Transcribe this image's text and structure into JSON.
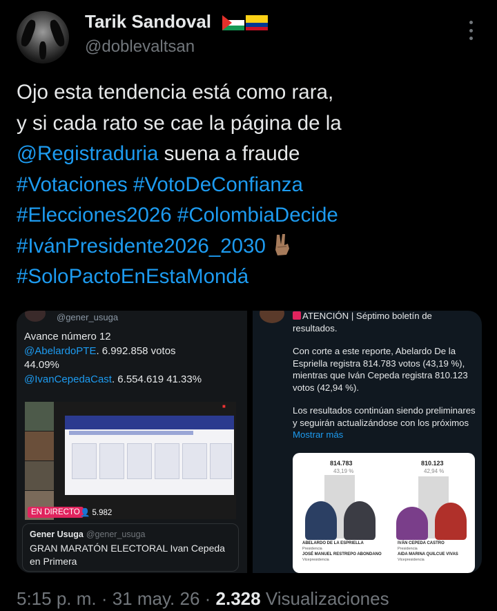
{
  "author": {
    "name": "Tarik Sandoval",
    "handle": "@doblevaltsan",
    "flags": [
      "palestine-flag",
      "colombia-flag"
    ]
  },
  "tweet": {
    "line1": "Ojo esta tendencia está como rara,",
    "line2": "y si cada rato se cae la página de la",
    "mention": "@Registraduria",
    "line3_rest": " suena a fraude",
    "hashtags": {
      "votaciones": "#Votaciones",
      "voto": "#VotoDeConfianza",
      "elecciones": "#Elecciones2026",
      "colombia": "#ColombiaDecide",
      "ivan": "#IvánPresidente2026_2030",
      "solo": "#SoloPactoEnEstaMondá"
    }
  },
  "left_panel": {
    "handle": "@gener_usuga",
    "advance": "Avance número 12",
    "mention1": "@AbelardoPTE",
    "votes1": ". 6.992.858 votos",
    "pct1": "44.09%",
    "mention2": "@IvanCepedaCast",
    "votes2": ". 6.554.619 41.33%",
    "live_label": "EN DIRECTO",
    "viewers": "5.982",
    "quote_author": "Gener Usuga",
    "quote_handle": "@gener_usuga",
    "quote_text": "GRAN MARATÓN ELECTORAL Ivan Cepeda en Primera"
  },
  "right_panel": {
    "alert": "ATENCIÓN | Séptimo boletín de resultados.",
    "para1": "Con corte a este reporte, Abelardo De la Espriella registra 814.783 votos (43,19 %), mientras que Iván Cepeda registra 810.123 votos (42,94 %).",
    "para2": "Los resultados continúan siendo preliminares y seguirán actualizándose con los próximos ",
    "show_more": "Mostrar más",
    "chart": {
      "left_value": "814.783",
      "left_pct": "43,19 %",
      "right_value": "810.123",
      "right_pct": "42,94 %",
      "left_name": "ABELARDO DE LA ESPRIELLA",
      "left_role": "Presidencia",
      "left_vp": "JOSÉ MANUEL RESTREPO ABONDANO",
      "left_vp_role": "Vicepresidencia",
      "right_name": "IVÁN CEPEDA CASTRO",
      "right_role": "Presidencia",
      "right_vp": "AIDA MARINA QUILCUE VIVAS",
      "right_vp_role": "Vicepresidencia"
    }
  },
  "footer": {
    "time": "5:15 p. m. · 31 may. 26 · ",
    "views": "2.328",
    "views_label": " Visualizaciones"
  }
}
